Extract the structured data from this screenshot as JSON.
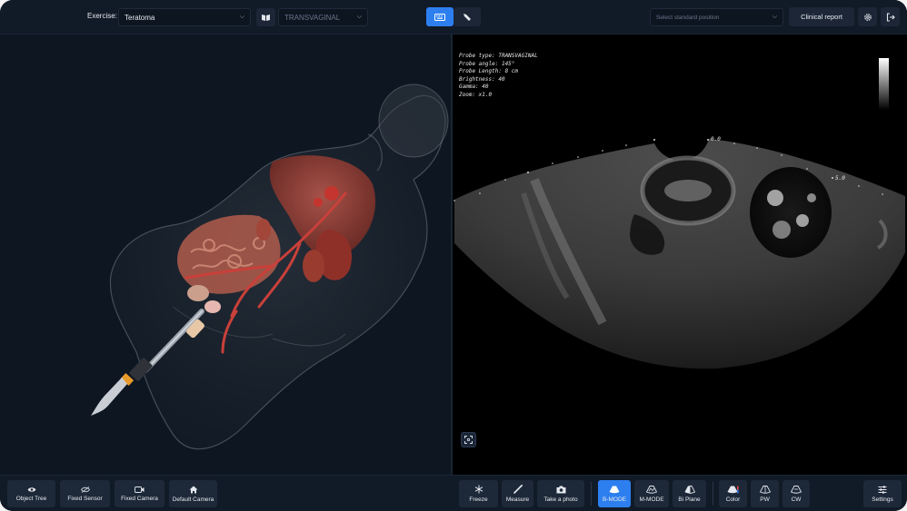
{
  "header": {
    "exercise_label": "Exercise:",
    "exercise_value": "Teratoma",
    "probe_value": "TRANSVAGINAL",
    "position_placeholder": "Select standard position",
    "clinical_report_label": "Clinical report"
  },
  "probe_info": {
    "type": "Probe type: TRANSVAGINAL",
    "angle": "Probe angle: 145°",
    "length": "Probe Length: 8 cm",
    "brightness": "Brightness: 40",
    "gamma": "Gamma: 40",
    "zoom": "Zoom: x1.0"
  },
  "depth_labels": {
    "top": "0.0",
    "right": "5.0"
  },
  "left_toolbar": [
    {
      "label": "Object Tree",
      "icon": "eye-icon"
    },
    {
      "label": "Fixed Sensor",
      "icon": "eye-off-icon"
    },
    {
      "label": "Fixed Camera",
      "icon": "video-icon"
    },
    {
      "label": "Default Camera",
      "icon": "home-icon"
    }
  ],
  "right_toolbar": {
    "freeze": "Freeze",
    "measure": "Measure",
    "photo": "Take a photo",
    "bmode": "B-MODE",
    "mmode": "M-MODE",
    "biplane": "Bi Plane",
    "color": "Color",
    "pw": "PW",
    "cw": "CW",
    "settings": "Settings"
  },
  "colors": {
    "accent": "#2d7ff0",
    "panel": "#111a27",
    "background": "#0a111b"
  }
}
